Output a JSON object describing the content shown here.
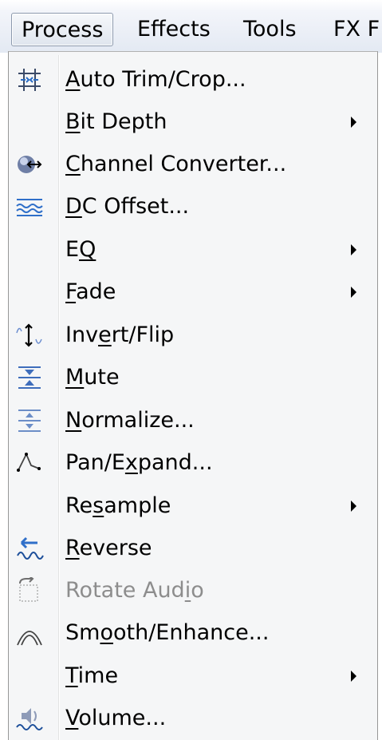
{
  "menubar": {
    "items": [
      {
        "label": "Process",
        "underline": "",
        "rest": "",
        "active": true
      },
      {
        "label": "Effects"
      },
      {
        "label": "Tools"
      },
      {
        "label": "FX F"
      }
    ]
  },
  "menu": {
    "items": [
      {
        "name": "auto-trim-crop",
        "icon": "auto-trim-icon",
        "pre": "",
        "u": "A",
        "post": "uto Trim/Crop...",
        "submenu": false,
        "enabled": true
      },
      {
        "name": "bit-depth",
        "icon": "",
        "pre": "",
        "u": "B",
        "post": "it Depth",
        "submenu": true,
        "enabled": true
      },
      {
        "name": "channel-converter",
        "icon": "channel-converter-icon",
        "pre": "",
        "u": "C",
        "post": "hannel Converter...",
        "submenu": false,
        "enabled": true
      },
      {
        "name": "dc-offset",
        "icon": "dc-offset-icon",
        "pre": "",
        "u": "D",
        "post": "C Offset...",
        "submenu": false,
        "enabled": true
      },
      {
        "name": "eq",
        "icon": "",
        "pre": "E",
        "u": "Q",
        "post": "",
        "submenu": true,
        "enabled": true
      },
      {
        "name": "fade",
        "icon": "",
        "pre": "",
        "u": "F",
        "post": "ade",
        "submenu": true,
        "enabled": true
      },
      {
        "name": "invert-flip",
        "icon": "invert-flip-icon",
        "pre": "Inv",
        "u": "e",
        "post": "rt/Flip",
        "submenu": false,
        "enabled": true
      },
      {
        "name": "mute",
        "icon": "mute-icon",
        "pre": "",
        "u": "M",
        "post": "ute",
        "submenu": false,
        "enabled": true
      },
      {
        "name": "normalize",
        "icon": "normalize-icon",
        "pre": "",
        "u": "N",
        "post": "ormalize...",
        "submenu": false,
        "enabled": true
      },
      {
        "name": "pan-expand",
        "icon": "pan-expand-icon",
        "pre": "Pan/E",
        "u": "x",
        "post": "pand...",
        "submenu": false,
        "enabled": true
      },
      {
        "name": "resample",
        "icon": "",
        "pre": "Re",
        "u": "s",
        "post": "ample",
        "submenu": true,
        "enabled": true
      },
      {
        "name": "reverse",
        "icon": "reverse-icon",
        "pre": "",
        "u": "R",
        "post": "everse",
        "submenu": false,
        "enabled": true
      },
      {
        "name": "rotate-audio",
        "icon": "rotate-audio-icon",
        "pre": "Rotate Aud",
        "u": "i",
        "post": "o",
        "submenu": false,
        "enabled": false
      },
      {
        "name": "smooth-enhance",
        "icon": "smooth-enhance-icon",
        "pre": "Sm",
        "u": "o",
        "post": "oth/Enhance...",
        "submenu": false,
        "enabled": true
      },
      {
        "name": "time",
        "icon": "",
        "pre": "",
        "u": "T",
        "post": "ime",
        "submenu": true,
        "enabled": true
      },
      {
        "name": "volume",
        "icon": "volume-icon",
        "pre": "",
        "u": "V",
        "post": "olume...",
        "submenu": false,
        "enabled": true
      }
    ]
  }
}
